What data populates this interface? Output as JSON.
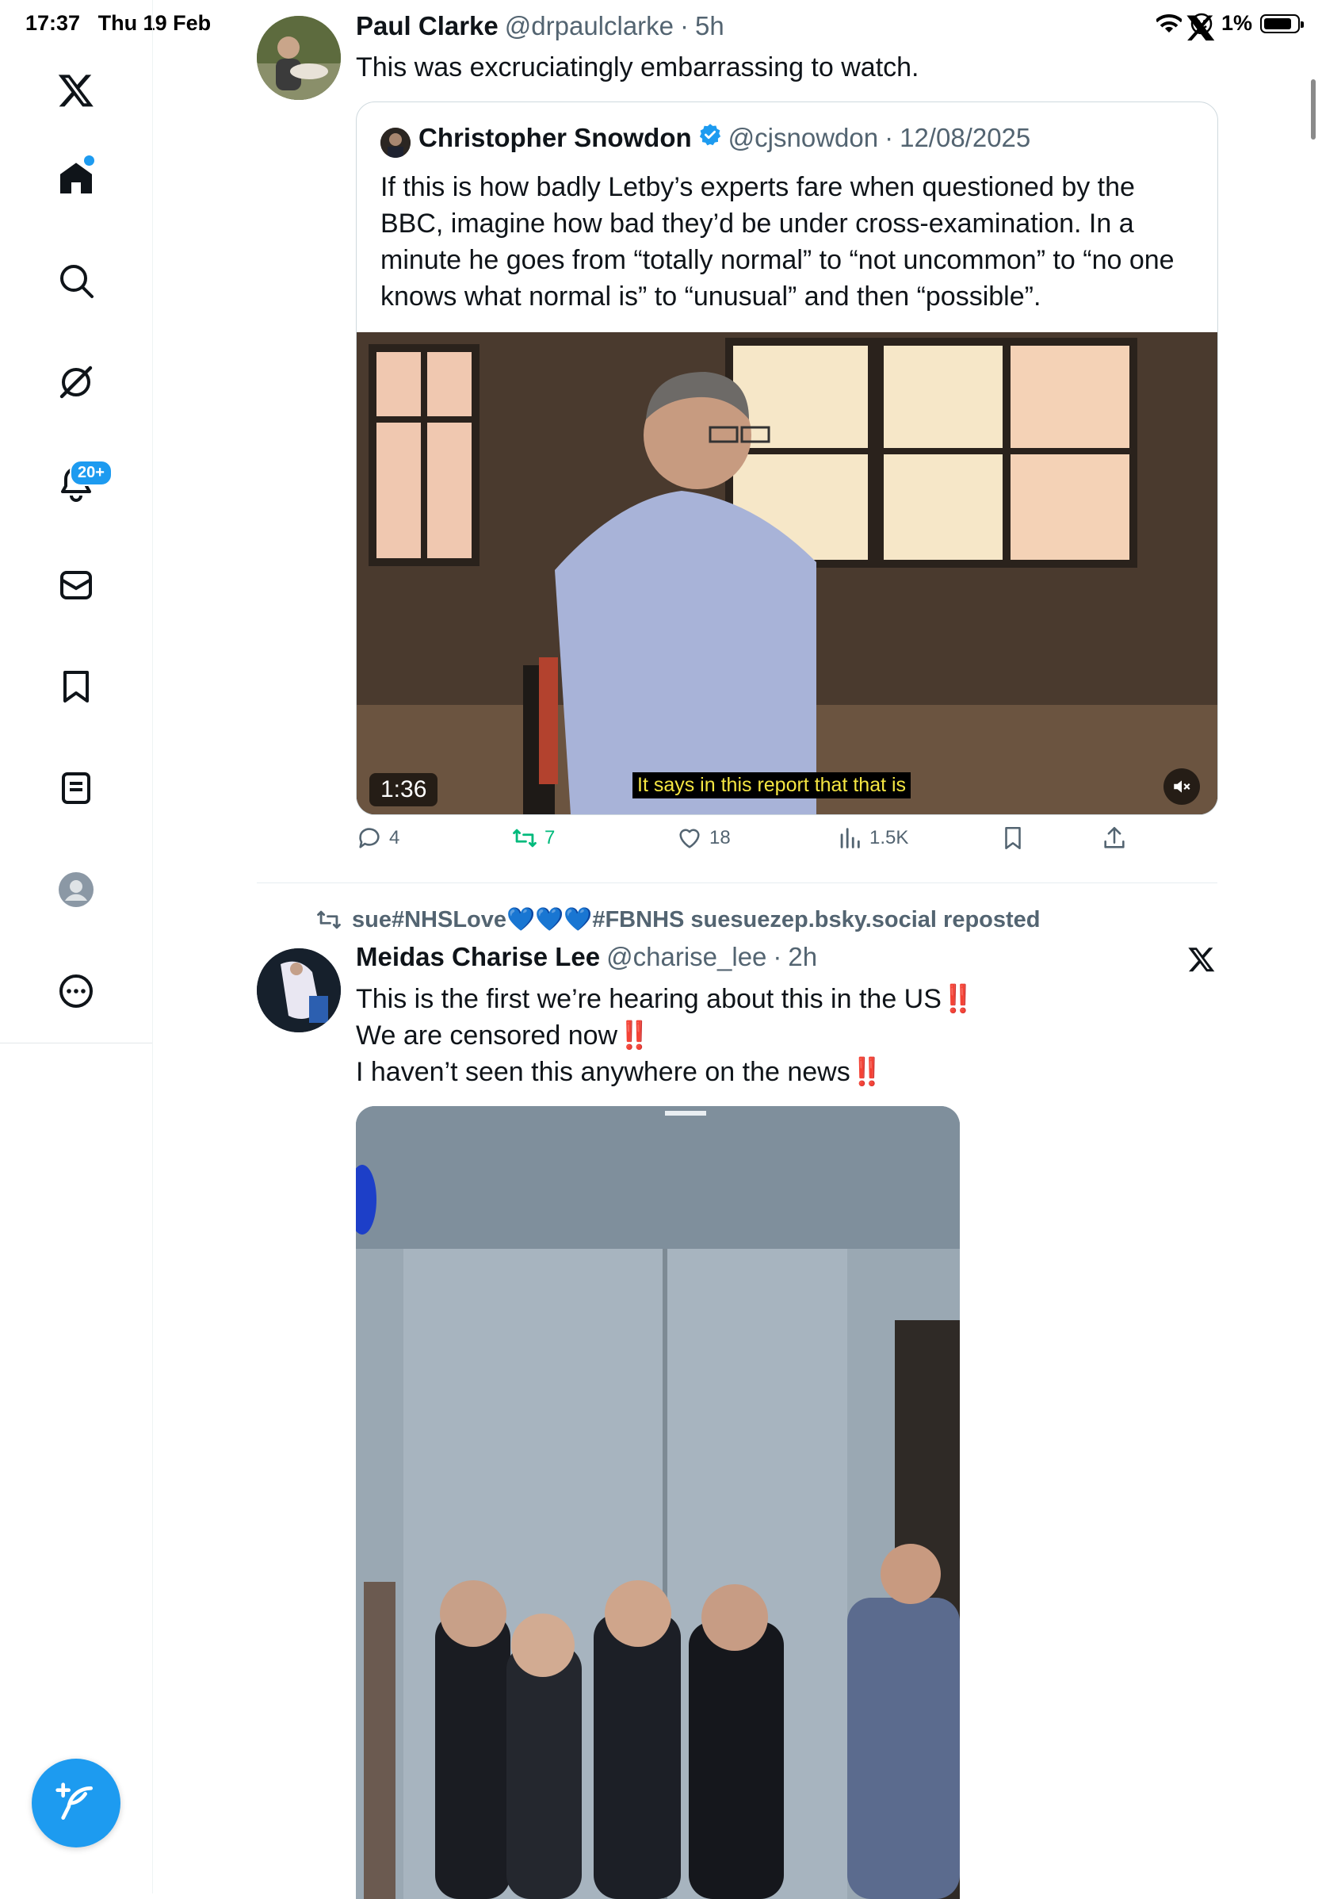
{
  "status_bar": {
    "time": "17:37",
    "date": "Thu 19 Feb",
    "battery": "1%"
  },
  "sidebar": {
    "items": [
      {
        "name": "x-logo"
      },
      {
        "name": "home"
      },
      {
        "name": "search"
      },
      {
        "name": "grok"
      },
      {
        "name": "notifications"
      },
      {
        "name": "messages"
      },
      {
        "name": "bookmarks"
      },
      {
        "name": "lists"
      },
      {
        "name": "profile"
      },
      {
        "name": "more"
      }
    ],
    "notifications_badge": "20+"
  },
  "tweet1": {
    "author_name": "Paul Clarke",
    "handle": "@drpaulclarke",
    "time": "5h",
    "text": "This was excruciatingly embarrassing to watch.",
    "quote": {
      "author_name": "Christopher Snowdon",
      "handle": "@cjsnowdon",
      "date": "12/08/2025",
      "text": "If this is how badly Letby’s experts fare when questioned by the BBC, imagine how bad they’d be under cross-examination. In a minute he goes from “totally normal” to “not uncommon” to “no one knows what normal is” to “unusual” and then “possible”.",
      "video": {
        "duration": "1:36",
        "subtitle": "It says in this report that that is"
      }
    },
    "stats": {
      "replies": "4",
      "reposts": "7",
      "likes": "18",
      "views": "1.5K"
    }
  },
  "tweet2": {
    "reposted_by": "sue#NHSLove💙💙💙#FBNHS suesuezep.bsky.social reposted",
    "author_name": "Meidas Charise Lee",
    "handle": "@charise_lee",
    "time": "2h",
    "lines": [
      "This is the first we’re hearing about this in the US",
      "We are censored now",
      "I haven’t seen this anywhere on the news"
    ],
    "bangs": "‼️"
  },
  "colors": {
    "accent": "#1d9bf0",
    "repost_green": "#00ba7c",
    "text": "#0f1419",
    "muted": "#536471"
  }
}
